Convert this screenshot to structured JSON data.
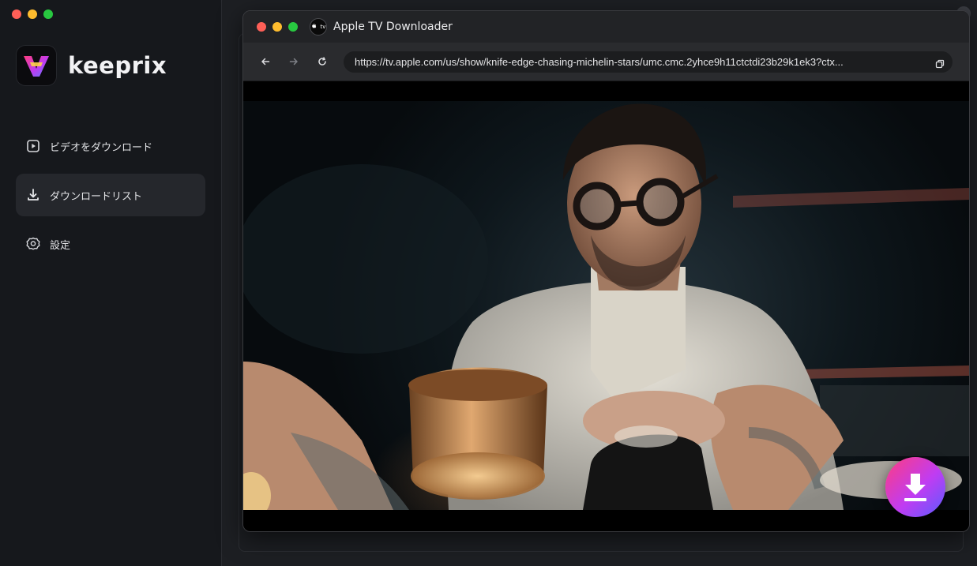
{
  "app": {
    "brand_name": "keeprix",
    "nav": [
      {
        "label": "ビデオをダウンロード",
        "icon": "play-square-icon",
        "active": false
      },
      {
        "label": "ダウンロードリスト",
        "icon": "download-icon",
        "active": true
      },
      {
        "label": "設定",
        "icon": "gear-icon",
        "active": false
      }
    ]
  },
  "browser": {
    "title": "Apple TV Downloader",
    "tv_badge": "tv",
    "url": "https://tv.apple.com/us/show/knife-edge-chasing-michelin-stars/umc.cmc.2yhce9h11ctctdi23b29k1ek3?ctx...",
    "toolbar_icons": [
      "back-arrow-icon",
      "forward-arrow-icon",
      "reload-icon",
      "copy-icon"
    ]
  },
  "colors": {
    "accent_gradient_start": "#ff3d7f",
    "accent_gradient_mid": "#c03cf2",
    "accent_gradient_end": "#5a5cff",
    "sidebar_bg": "#16181c",
    "active_nav_bg": "#25272c"
  }
}
